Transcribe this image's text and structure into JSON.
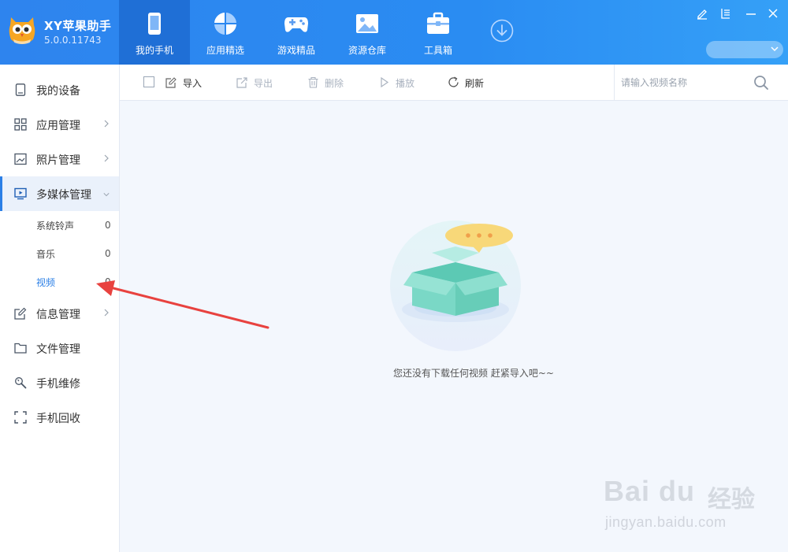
{
  "app": {
    "name": "XY苹果助手",
    "version": "5.0.0.11743"
  },
  "nav": {
    "tabs": [
      {
        "label": "我的手机",
        "icon": "phone-icon",
        "active": true
      },
      {
        "label": "应用精选",
        "icon": "apps-icon",
        "active": false
      },
      {
        "label": "游戏精品",
        "icon": "gamepad-icon",
        "active": false
      },
      {
        "label": "资源仓库",
        "icon": "image-icon",
        "active": false
      },
      {
        "label": "工具箱",
        "icon": "toolbox-icon",
        "active": false
      }
    ]
  },
  "sidebar": {
    "items": [
      {
        "label": "我的设备",
        "icon": "device-icon"
      },
      {
        "label": "应用管理",
        "icon": "grid-icon"
      },
      {
        "label": "照片管理",
        "icon": "photo-icon"
      },
      {
        "label": "多媒体管理",
        "icon": "monitor-play-icon",
        "expanded": true
      },
      {
        "label": "信息管理",
        "icon": "edit-icon"
      },
      {
        "label": "文件管理",
        "icon": "folder-icon"
      },
      {
        "label": "手机维修",
        "icon": "wrench-icon"
      },
      {
        "label": "手机回收",
        "icon": "recycle-frame-icon"
      }
    ],
    "subitems": [
      {
        "label": "系统铃声",
        "count": "0"
      },
      {
        "label": "音乐",
        "count": "0"
      },
      {
        "label": "视频",
        "count": "0",
        "active": true
      }
    ]
  },
  "toolbar": {
    "import": "导入",
    "export": "导出",
    "delete": "删除",
    "play": "播放",
    "refresh": "刷新",
    "search_placeholder": "请输入视频名称"
  },
  "content": {
    "empty_text": "您还没有下载任何视频  赶紧导入吧~~"
  },
  "watermark": {
    "baidu": "Bai du",
    "jingyan": "经验",
    "url": "jingyan.baidu.com"
  },
  "colors": {
    "header": "#2e84ee",
    "active_tab": "#1f6fd6",
    "accent": "#2b7fe6",
    "arrow": "#e8423f"
  }
}
